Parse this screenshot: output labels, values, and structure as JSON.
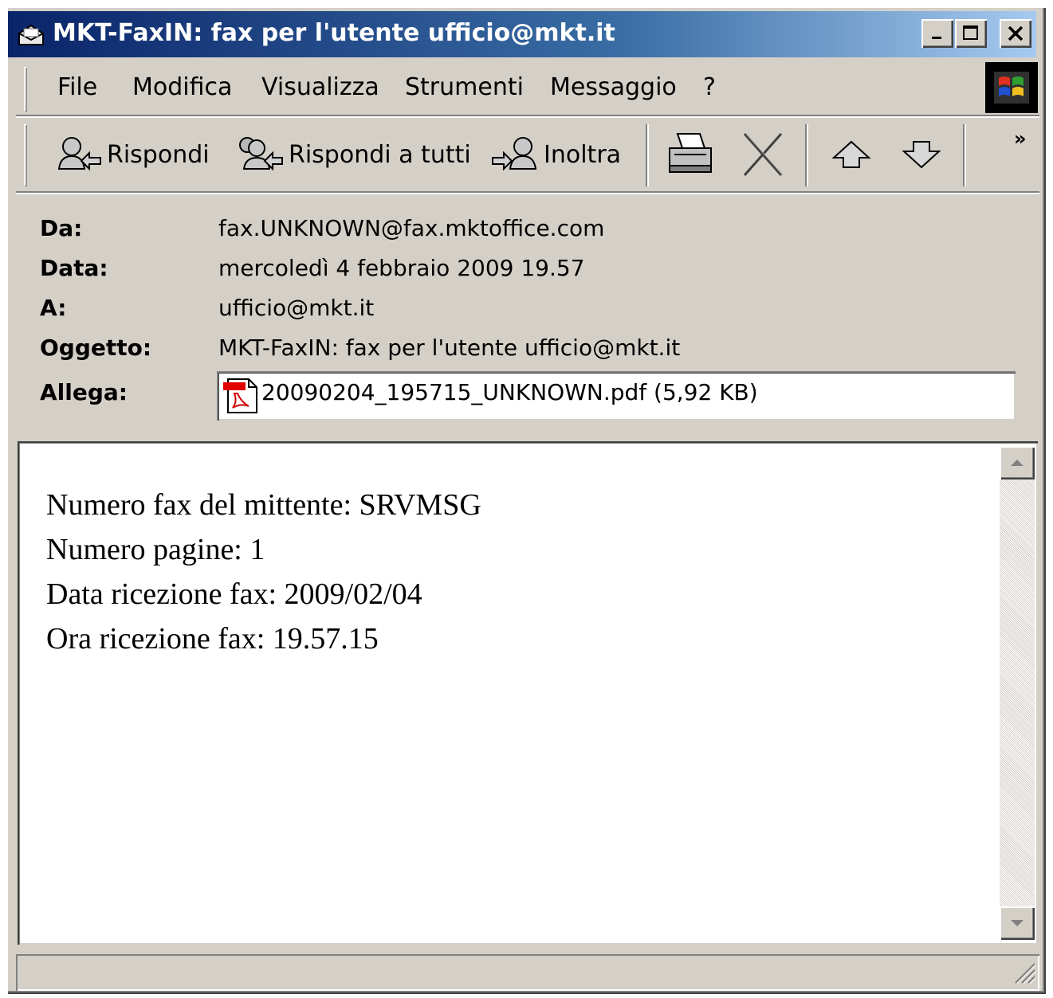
{
  "window": {
    "title": "MKT-FaxIN: fax per l'utente ufficio@mkt.it"
  },
  "menu": [
    {
      "label": "File"
    },
    {
      "label": "Modifica"
    },
    {
      "label": "Visualizza"
    },
    {
      "label": "Strumenti"
    },
    {
      "label": "Messaggio"
    },
    {
      "label": "?"
    }
  ],
  "toolbar": {
    "reply_label": "Rispondi",
    "reply_all_label": "Rispondi a tutti",
    "forward_label": "Inoltra",
    "overflow": "»"
  },
  "header": {
    "from_label": "Da:",
    "from_value": "fax.UNKNOWN@fax.mktoffice.com",
    "date_label": "Data:",
    "date_value": "mercoledì 4 febbraio 2009 19.57",
    "to_label": "A:",
    "to_value": "ufficio@mkt.it",
    "subject_label": "Oggetto:",
    "subject_value": "MKT-FaxIN: fax per l'utente ufficio@mkt.it",
    "attach_label": "Allega:",
    "attach_value": "20090204_195715_UNKNOWN.pdf (5,92 KB)"
  },
  "body": {
    "lines": [
      "Numero fax del mittente: SRVMSG",
      "Numero pagine: 1",
      "Data ricezione fax: 2009/02/04",
      "Ora ricezione fax: 19.57.15"
    ]
  },
  "colors": {
    "titlebar_start": "#0a246a",
    "titlebar_end": "#a6caf0",
    "face": "#d4d0c8"
  }
}
